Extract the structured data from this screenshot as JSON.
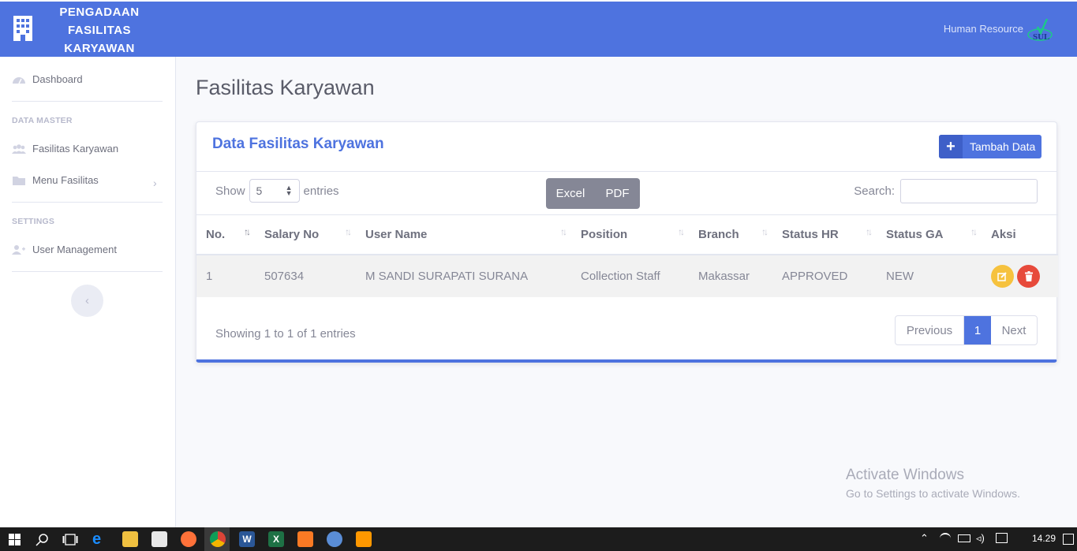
{
  "header": {
    "brand_line1": "PENGADAAN",
    "brand_line2": "FASILITAS",
    "brand_line3": "KARYAWAN",
    "user": "Human Resource"
  },
  "sidebar": {
    "dashboard": "Dashboard",
    "section_master": "DATA MASTER",
    "fasilitas": "Fasilitas Karyawan",
    "menu_fasilitas": "Menu Fasilitas",
    "section_settings": "SETTINGS",
    "user_management": "User Management"
  },
  "page": {
    "title": "Fasilitas Karyawan",
    "card_title": "Data Fasilitas Karyawan",
    "add_button": "Tambah Data",
    "show_label": "Show",
    "entries_value": "5",
    "entries_label": "entries",
    "export_excel": "Excel",
    "export_pdf": "PDF",
    "search_label": "Search:",
    "columns": [
      "No.",
      "Salary No",
      "User Name",
      "Position",
      "Branch",
      "Status HR",
      "Status GA",
      "Aksi"
    ],
    "rows": [
      {
        "no": "1",
        "salary_no": "507634",
        "user_name": "M SANDI SURAPATI SURANA",
        "position": "Collection Staff",
        "branch": "Makassar",
        "status_hr": "APPROVED",
        "status_ga": "NEW"
      }
    ],
    "info": "Showing 1 to 1 of 1 entries",
    "pager_prev": "Previous",
    "pager_current": "1",
    "pager_next": "Next"
  },
  "watermark": {
    "line1": "Activate Windows",
    "line2": "Go to Settings to activate Windows."
  },
  "taskbar": {
    "clock": "14.29"
  },
  "colors": {
    "primary": "#4e73df",
    "warning": "#f6c23e",
    "danger": "#e74a3b"
  }
}
